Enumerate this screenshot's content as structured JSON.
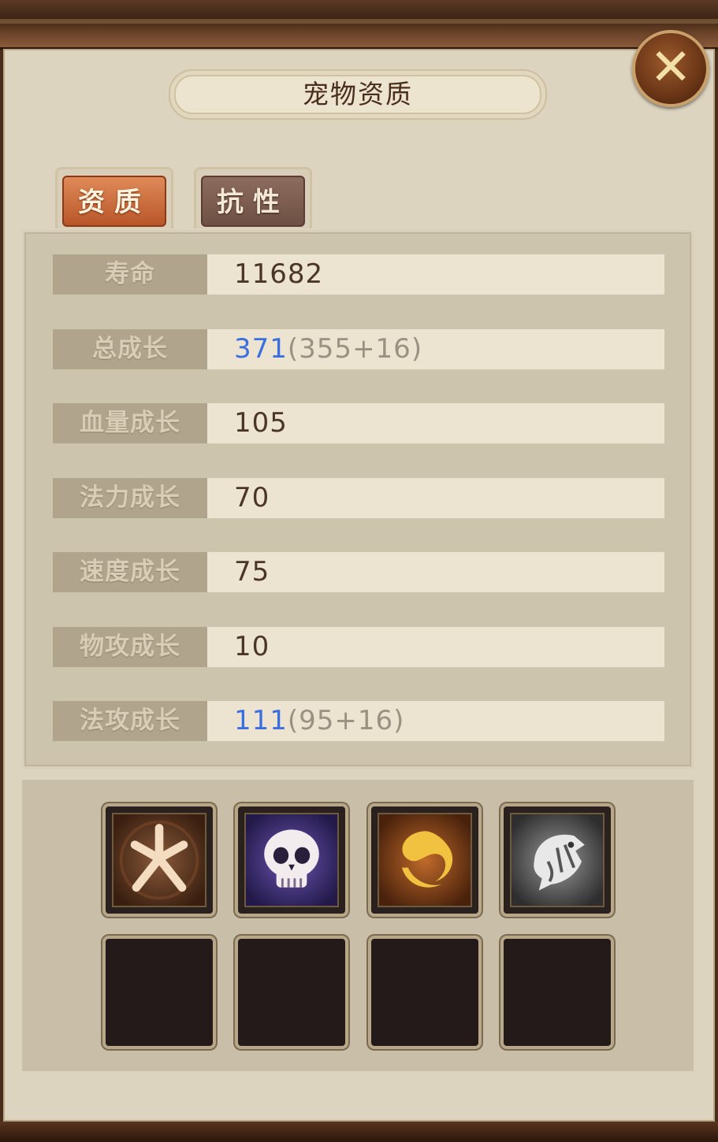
{
  "window": {
    "title": "宠物资质"
  },
  "tabs": [
    {
      "label": "资质",
      "active": true
    },
    {
      "label": "抗性",
      "active": false
    }
  ],
  "stats": [
    {
      "label": "寿命",
      "value": "11682"
    },
    {
      "label": "总成长",
      "value": "371",
      "detail": "(355+16)"
    },
    {
      "label": "血量成长",
      "value": "105"
    },
    {
      "label": "法力成长",
      "value": "70"
    },
    {
      "label": "速度成长",
      "value": "75"
    },
    {
      "label": "物攻成长",
      "value": "10"
    },
    {
      "label": "法攻成长",
      "value": "111",
      "detail": "(95+16)"
    }
  ],
  "skills": [
    {
      "icon": "stick-figure-skill-icon",
      "filled": true
    },
    {
      "icon": "skull-skill-icon",
      "filled": true
    },
    {
      "icon": "yin-swirl-skill-icon",
      "filled": true
    },
    {
      "icon": "silver-beast-skill-icon",
      "filled": true
    },
    {
      "icon": "",
      "filled": false
    },
    {
      "icon": "",
      "filled": false
    },
    {
      "icon": "",
      "filled": false
    },
    {
      "icon": "",
      "filled": false
    }
  ],
  "colors": {
    "highlight_value": "#3b6fe0",
    "detail_value": "#9a9183",
    "active_tab": "#c76a3c",
    "inactive_tab": "#7c5e50",
    "panel_bg": "#ddd4c0"
  },
  "close": {
    "icon": "close-x-icon"
  }
}
